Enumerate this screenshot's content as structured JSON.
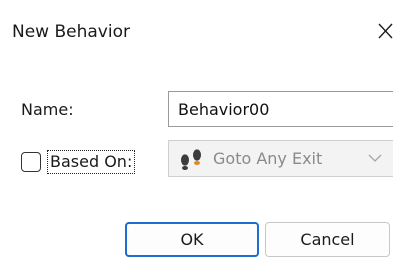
{
  "dialog": {
    "title": "New Behavior"
  },
  "form": {
    "name_label": "Name:",
    "name_value": "Behavior00",
    "based_on_label": "Based On:",
    "based_on_checked": false,
    "based_on_selected": "Goto Any Exit",
    "based_on_icon": "footprints-icon"
  },
  "buttons": {
    "ok_label": "OK",
    "cancel_label": "Cancel"
  },
  "colors": {
    "accent": "#1c6fd1",
    "disabled_text": "#8a8a8a"
  }
}
